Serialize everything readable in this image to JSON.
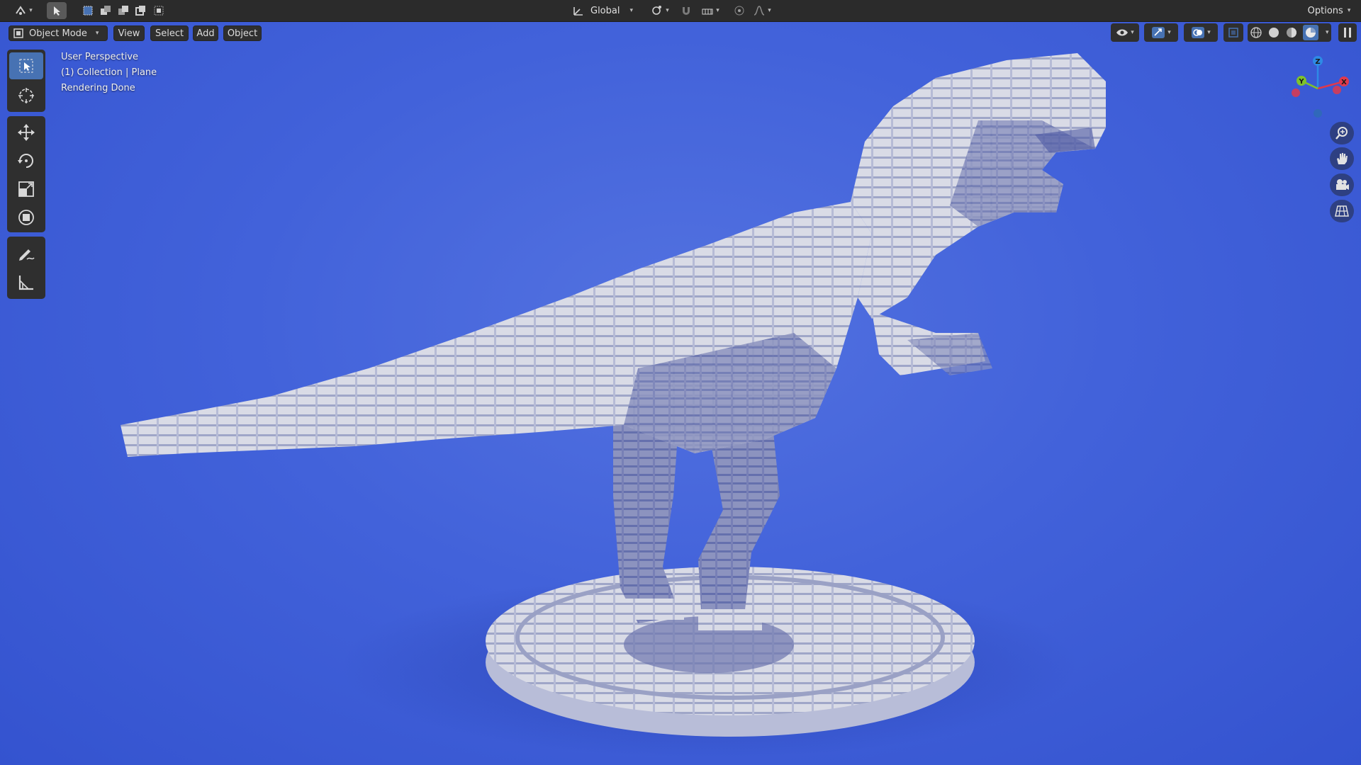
{
  "header": {
    "transform_orientation": "Global",
    "options_label": "Options"
  },
  "menu": {
    "mode": "Object Mode",
    "view": "View",
    "select": "Select",
    "add": "Add",
    "object": "Object"
  },
  "viewport_info": {
    "perspective": "User Perspective",
    "collection": "(1) Collection | Plane",
    "status": "Rendering Done"
  },
  "gizmo": {
    "x": "X",
    "y": "Y",
    "z": "Z",
    "colors": {
      "x": "#e0394c",
      "y": "#7fc22b",
      "z": "#2e8ae6"
    }
  },
  "tools": [
    "select-box-icon",
    "cursor-icon",
    "move-icon",
    "rotate-icon",
    "scale-icon",
    "transform-icon",
    "annotate-icon",
    "measure-icon"
  ],
  "nav_icons": [
    "zoom-icon",
    "pan-hand-icon",
    "camera-icon",
    "grid-view-icon"
  ],
  "colors": {
    "background": "#4466dd",
    "header": "#2b2b2b",
    "active_tool": "#4772b3"
  }
}
